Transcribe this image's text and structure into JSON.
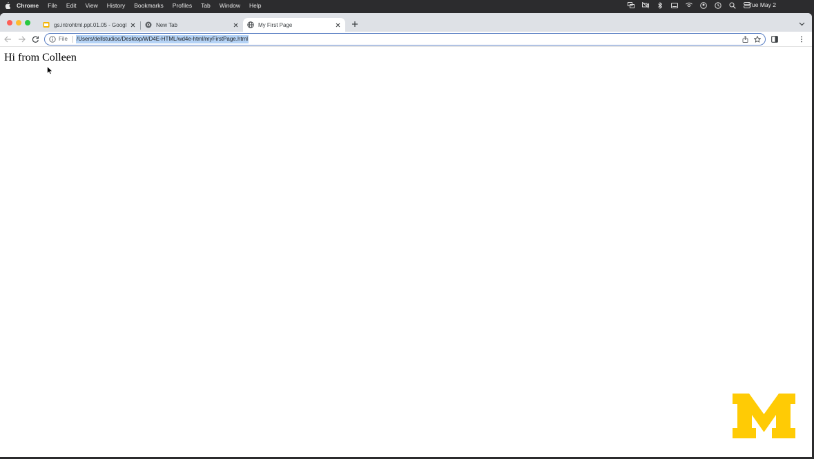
{
  "menubar": {
    "items": [
      "Chrome",
      "File",
      "Edit",
      "View",
      "History",
      "Bookmarks",
      "Profiles",
      "Tab",
      "Window",
      "Help"
    ],
    "clock": "Tue May 2"
  },
  "tabs": [
    {
      "title": "gs.introhtml.ppt.01.05 - Googl",
      "favicon": "slides-icon",
      "active": false
    },
    {
      "title": "New Tab",
      "favicon": "chrome-icon",
      "active": false
    },
    {
      "title": "My First Page",
      "favicon": "globe-icon",
      "active": true
    }
  ],
  "omnibox": {
    "scheme": "File",
    "url": "/Users/dellstudioc/Desktop/WD4E-HTML/wd4e-html/myFirstPage.html"
  },
  "page": {
    "text": "Hi from Colleen"
  },
  "logo": {
    "text": "M",
    "color": "#ffcb05"
  }
}
